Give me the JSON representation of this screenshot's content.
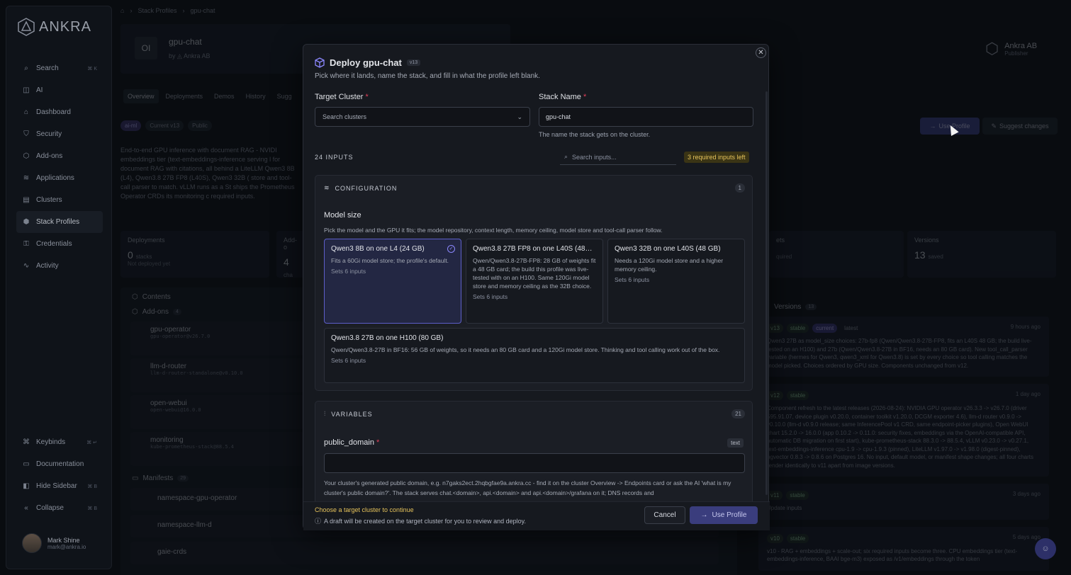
{
  "app": {
    "brand": "ANKRA"
  },
  "sidebar": {
    "items": [
      {
        "label": "Search",
        "icon": "search-icon",
        "kbd": "⌘ K"
      },
      {
        "label": "AI",
        "icon": "robot-icon"
      },
      {
        "label": "Dashboard",
        "icon": "home-icon"
      },
      {
        "label": "Security",
        "icon": "shield-icon"
      },
      {
        "label": "Add-ons",
        "icon": "cube-icon"
      },
      {
        "label": "Applications",
        "icon": "layers-icon"
      },
      {
        "label": "Clusters",
        "icon": "server-icon"
      },
      {
        "label": "Stack Profiles",
        "icon": "package-icon"
      },
      {
        "label": "Credentials",
        "icon": "key-icon"
      },
      {
        "label": "Activity",
        "icon": "activity-icon"
      }
    ],
    "bottom": [
      {
        "label": "Keybinds",
        "icon": "command-icon",
        "kbd": "⌘ ↵"
      },
      {
        "label": "Documentation",
        "icon": "doc-icon"
      },
      {
        "label": "Hide Sidebar",
        "icon": "panel-icon",
        "kbd": "⌘ B"
      },
      {
        "label": "Collapse",
        "icon": "chevrons-left-icon",
        "kbd": "⌘ B"
      }
    ],
    "user": {
      "name": "Mark Shine",
      "email": "mark@ankra.io"
    }
  },
  "background": {
    "breadcrumb": [
      "Stack Profiles",
      "gpu-chat"
    ],
    "profile": {
      "tile": "OI",
      "title": "gpu-chat",
      "by": "by",
      "org": "Ankra AB"
    },
    "publisher": {
      "name": "Ankra AB",
      "role": "Publisher"
    },
    "tabs": [
      "Overview",
      "Deployments",
      "Demos",
      "History",
      "Sugg"
    ],
    "chips": [
      "ai-ml",
      "Current v13",
      "Public"
    ],
    "description": "End-to-end GPU inference with document RAG - NVIDI embeddings tier (text-embeddings-inference serving l for document RAG with citations, all behind a LiteLLM Qwen3 8B (L4), Qwen3.8 27B FP8 (L40S), Qwen3 32B ( store and tool-call parser to match. vLLM runs as a St ships the Prometheus Operator CRDs its monitoring c required inputs.",
    "buttons": {
      "use_profile": "Use Profile",
      "suggest": "Suggest changes"
    },
    "stats": {
      "deployments": {
        "label": "Deployments",
        "value": "0",
        "unit": "stacks",
        "sub": "Not deployed yet"
      },
      "addons": {
        "label": "Add-o",
        "value": "4",
        "unit": "cha"
      },
      "secrets": {
        "label": "ets",
        "sub": "quired"
      },
      "versions": {
        "label": "Versions",
        "value": "13",
        "unit": "saved"
      }
    },
    "contents": {
      "title": "Contents",
      "addons_label": "Add-ons",
      "addons_count": "4",
      "addons": [
        {
          "name": "gpu-operator",
          "ver": "gpu-operator@v26.7.0"
        },
        {
          "name": "llm-d-router",
          "ver": "llm-d-router-standalone@v0.10.0"
        },
        {
          "name": "open-webui",
          "ver": "open-webui@16.0.0"
        },
        {
          "name": "monitoring",
          "ver": "kube-prometheus-stack@88.5.4"
        }
      ],
      "manifests_label": "Manifests",
      "manifests_count": "29",
      "manifests": [
        "namespace-gpu-operator",
        "namespace-llm-d",
        "gaie-crds"
      ]
    },
    "versions": {
      "title": "Versions",
      "count": "13",
      "items": [
        {
          "ver": "v13",
          "tags": [
            "stable",
            "current",
            "latest"
          ],
          "time": "9 hours ago",
          "text": "Qwen3 27B as model_size choices: 27b-fp8 (Qwen/Qwen3.8-27B-FP8, fits an L40S 48 GB; the build live-tested on an H100) and 27b (Qwen/Qwen3.8-27B in BF16, needs an 80 GB card). New tool_call_parser variable (hermes for Qwen3, qwen3_xml for Qwen3.8) is set by every choice so tool calling matches the model picked. Choices ordered by GPU size. Components unchanged from v12."
        },
        {
          "ver": "v12",
          "tags": [
            "stable"
          ],
          "time": "1 day ago",
          "text": "Component refresh to the latest releases (2026-08-24): NVIDIA GPU operator v26.3.3 -> v26.7.0 (driver 595.91.07, device plugin v0.20.0, container toolkit v1.20.0, DCGM exporter 4.6), llm-d router v0.9.0 -> v0.10.0 (llm-d v0.9.0 release; same InferencePool v1 CRD, same endpoint-picker plugins), Open WebUI chart 15.2.0 -> 16.0.0 (app 0.10.2 -> 0.11.0: security fixes, embeddings via the OpenAI-compatible API, automatic DB migration on first start), kube-prometheus-stack 88.3.0 -> 88.5.4, vLLM v0.23.0 -> v0.27.1, text-embeddings-inference cpu-1.9 -> cpu-1.9.3 (pinned), LiteLLM v1.97.0 -> v1.98.0 (digest-pinned), pgvector 0.8.3 -> 0.8.6 on Postgres 16. No input, default model, or manifest shape changes; all four charts render identically to v11 apart from image versions."
        },
        {
          "ver": "v11",
          "tags": [
            "stable"
          ],
          "time": "3 days ago",
          "text": "Update inputs"
        },
        {
          "ver": "v10",
          "tags": [
            "stable"
          ],
          "time": "5 days ago",
          "text": "v10 - RAG + embeddings + scale-out; six required inputs become three. CPU embeddings tier (text-embeddings-inference, BAAI bge-m3) exposed as /v1/embeddings through the token"
        }
      ]
    }
  },
  "modal": {
    "title": "Deploy gpu-chat",
    "version": "v13",
    "subtitle": "Pick where it lands, name the stack, and fill in what the profile left blank.",
    "target_cluster": {
      "label": "Target Cluster",
      "req": "*",
      "placeholder": "Search clusters"
    },
    "stack_name": {
      "label": "Stack Name",
      "req": "*",
      "value": "gpu-chat",
      "hint": "The name the stack gets on the cluster."
    },
    "inputs": {
      "count": "24 INPUTS",
      "search_placeholder": "Search inputs...",
      "required_left": "3 required inputs left"
    },
    "configuration": {
      "title": "CONFIGURATION",
      "count": "1",
      "field_label": "Model size",
      "field_desc": "Pick the model and the GPU it fits; the model repository, context length, memory ceiling, model store and tool-call parser follow.",
      "options": [
        {
          "title": "Qwen3 8B on one L4 (24 GB)",
          "desc": "Fits a 60Gi model store; the profile's default.",
          "sets": "Sets 6 inputs",
          "selected": true
        },
        {
          "title": "Qwen3.8 27B FP8 on one L40S (48…",
          "desc": "Qwen/Qwen3.8-27B-FP8: 28 GB of weights fit a 48 GB card; the build this profile was live-tested with on an H100. Same 120Gi model store and memory ceiling as the 32B choice.",
          "sets": "Sets 6 inputs",
          "selected": false
        },
        {
          "title": "Qwen3 32B on one L40S (48 GB)",
          "desc": "Needs a 120Gi model store and a higher memory ceiling.",
          "sets": "Sets 6 inputs",
          "selected": false
        },
        {
          "title": "Qwen3.8 27B on one H100 (80 GB)",
          "desc": "Qwen/Qwen3.8-27B in BF16: 56 GB of weights, so it needs an 80 GB card and a 120Gi model store. Thinking and tool calling work out of the box.",
          "sets": "Sets 6 inputs",
          "selected": false
        }
      ]
    },
    "variables": {
      "title": "VARIABLES",
      "count": "21",
      "field_label": "public_domain",
      "req": "*",
      "type": "text",
      "value": "",
      "desc": "Your cluster's generated public domain, e.g. n7gaks2ect.2hqbgfae9a.ankra.cc - find it on the cluster Overview -> Endpoints card or ask the AI 'what is my cluster's public domain?'. The stack serves chat.<domain>, api.<domain> and api.<domain>/grafana on it; DNS records and"
    },
    "footer": {
      "warning": "Choose a target cluster to continue",
      "info": "A draft will be created on the target cluster for you to review and deploy.",
      "cancel": "Cancel",
      "use": "Use Profile"
    }
  },
  "colors": {
    "accent": "#5d5fc9",
    "warning": "#e6c35b",
    "required": "#e0405a"
  }
}
